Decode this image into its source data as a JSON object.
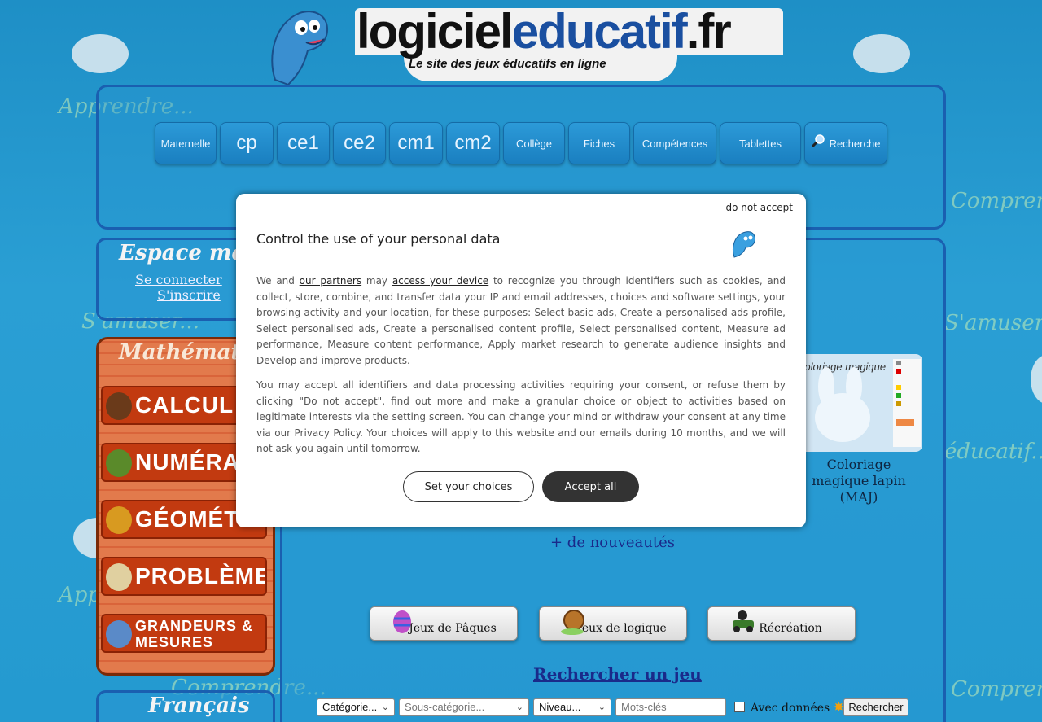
{
  "header": {
    "logo_part1": "logiciel",
    "logo_part2": "educatif",
    "logo_part3": ".fr",
    "tagline": "Le site des jeux éducatifs en ligne"
  },
  "background_texts": [
    "Apprendre...",
    "Comprendre...",
    "S'amuser...",
    "Comprendre...",
    "éducatif...",
    "Apprendre...",
    "Comprendre...",
    "Comprendre...",
    "S'amuser..."
  ],
  "nav": [
    {
      "label": "Maternelle",
      "size": "small"
    },
    {
      "label": "cp",
      "size": "big"
    },
    {
      "label": "ce1",
      "size": "big"
    },
    {
      "label": "ce2",
      "size": "big"
    },
    {
      "label": "cm1",
      "size": "big"
    },
    {
      "label": "cm2",
      "size": "big"
    },
    {
      "label": "Collège",
      "size": "small"
    },
    {
      "label": "Fiches",
      "size": "small"
    },
    {
      "label": "Compétences",
      "size": "small"
    },
    {
      "label": "Tablettes",
      "size": "small"
    },
    {
      "label": "Recherche",
      "size": "small",
      "icon": "search-icon"
    }
  ],
  "member": {
    "title": "Espace membre",
    "login": "Se connecter",
    "register": "S'inscrire"
  },
  "math": {
    "title": "Mathématiques",
    "items": [
      "CALCUL",
      "NUMÉRATION",
      "GÉOMÉTRIE",
      "PROBLÈMES",
      "GRANDEURS & MESURES"
    ]
  },
  "francais": {
    "title": "Français"
  },
  "thumb": {
    "title_text": "Coloriage magique",
    "caption": "Coloriage magique lapin (MAJ)"
  },
  "more_news": "+ de nouveautés",
  "categories": [
    {
      "label": "Jeux de Pâques",
      "icon": "easter-egg-icon"
    },
    {
      "label": "Jeux de logique",
      "icon": "snail-icon"
    },
    {
      "label": "Récréation",
      "icon": "car-icon"
    }
  ],
  "search": {
    "title": "Rechercher un jeu",
    "category": "Catégorie...",
    "subcategory": "Sous-catégorie...",
    "level": "Niveau...",
    "keywords_placeholder": "Mots-clés",
    "with_data": "Avec données",
    "submit": "Rechercher"
  },
  "consent": {
    "deny": "do not accept",
    "title": "Control the use of your personal data",
    "p1_a": "We and ",
    "p1_partners": "our partners",
    "p1_b": " may ",
    "p1_access": "access your device",
    "p1_c": " to recognize you through identifiers such as cookies, and collect, store, combine, and transfer data your IP and email addresses, choices and software settings, your browsing activity and your location, for these purposes: Select basic ads, Create a personalised ads profile, Select personalised ads, Create a personalised content profile, Select personalised content, Measure ad performance, Measure content performance, Apply market research to generate audience insights and Develop and improve products.",
    "p2": "You may accept all identifiers and data processing activities requiring your consent, or refuse them by clicking \"Do not accept\", find out more and make a granular choice or object to activities based on legitimate interests via the setting screen. You can change your mind or withdraw your consent at any time via our Privacy Policy. Your choices will apply to this website and our emails during 10 months, and we will not ask you again until tomorrow.",
    "choices": "Set your choices",
    "accept": "Accept all"
  },
  "colors": {
    "background": "#2a9fd4",
    "panel_border": "#1a5fb0",
    "math_panel": "#e07040",
    "link_dark": "#1a2a8a",
    "dialog_button": "#333333"
  }
}
